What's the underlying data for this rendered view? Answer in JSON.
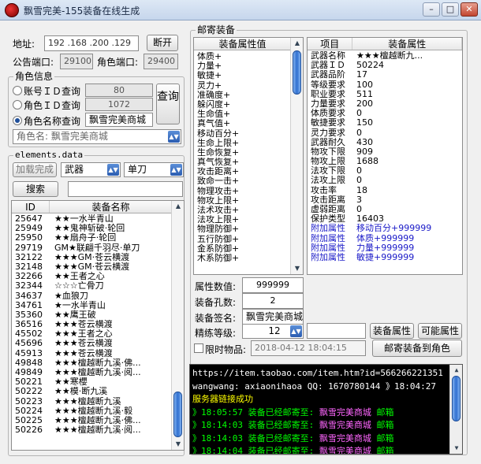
{
  "window": {
    "title": "飘雪完美-155装备在线生成"
  },
  "conn": {
    "addr_label": "地址:",
    "ip": "192 .168 .200 .129",
    "disconnect": "断开",
    "gm_port_label": "公告端口:",
    "gm_port": "29100",
    "role_port_label": "角色端口:",
    "role_port": "29400"
  },
  "role": {
    "group_title": "角色信息",
    "opt_account": "账号ＩＤ查询",
    "account_value": "80",
    "opt_roleid": "角色ＩＤ查询",
    "roleid_value": "1072",
    "opt_name": "角色名称查询",
    "name_value": "飘雪完美商城",
    "query": "查询",
    "rolename_combo": "角色名: 飘雪完美商城"
  },
  "elements": {
    "group_title": "elements.data",
    "load_btn": "加载完成",
    "cat1": "武器",
    "cat2": "单刀",
    "search_btn": "搜索",
    "search_value": "",
    "col_id": "ID",
    "col_name": "装备名称",
    "items": [
      {
        "id": "25647",
        "name": "★★一水半青山"
      },
      {
        "id": "25949",
        "name": "★★鬼神斩破·轮回"
      },
      {
        "id": "25950",
        "name": "★★扇舟子·轮回"
      },
      {
        "id": "29719",
        "name": "GM★联翩千羽尽·单刀"
      },
      {
        "id": "32122",
        "name": "★★★GM·苍云横渡"
      },
      {
        "id": "32148",
        "name": "★★★GM·苍云横渡"
      },
      {
        "id": "32266",
        "name": "★★王者之心"
      },
      {
        "id": "32344",
        "name": "☆☆☆亡骨刀"
      },
      {
        "id": "34637",
        "name": "★血狼刀"
      },
      {
        "id": "34761",
        "name": "★一水半青山"
      },
      {
        "id": "35360",
        "name": "★★鹰王破"
      },
      {
        "id": "36516",
        "name": "★★★苍云横渡"
      },
      {
        "id": "45502",
        "name": "★★★王者之心"
      },
      {
        "id": "45696",
        "name": "★★★苍云横渡"
      },
      {
        "id": "45913",
        "name": "★★★苍云横渡"
      },
      {
        "id": "49848",
        "name": "★★★檀越断九溪·佛..."
      },
      {
        "id": "49849",
        "name": "★★★檀越断九溪·阅..."
      },
      {
        "id": "50221",
        "name": "★★寒櫻"
      },
      {
        "id": "50222",
        "name": "★★模·断九溪"
      },
      {
        "id": "50223",
        "name": "★★★檀越断九溪"
      },
      {
        "id": "50224",
        "name": "★★★檀越断九溪·毅"
      },
      {
        "id": "50225",
        "name": "★★★檀越断九溪·佛..."
      },
      {
        "id": "50226",
        "name": "★★★檀越断九溪·阅..."
      }
    ]
  },
  "mail": {
    "group_title": "邮寄装备",
    "attr_header": "装备属性值",
    "attr_list": [
      "体质+",
      "力量+",
      "敏捷+",
      "灵力+",
      "准确度+",
      "躲闪度+",
      "生命值+",
      "真气值+",
      "移动百分+",
      "生命上限+",
      "生命恢复+",
      "真气恢复+",
      "攻击距离+",
      "致命一击+",
      "物理攻击+",
      "物攻上限+",
      "法术攻击+",
      "法攻上限+",
      "物理防御+",
      "五行防御+",
      "金系防御+",
      "木系防御+"
    ],
    "col_item": "项目",
    "col_prop": "装备属性",
    "props": [
      {
        "k": "武器名称",
        "v": "★★★檀越断九..."
      },
      {
        "k": "武器ＩＤ",
        "v": "50224"
      },
      {
        "k": "武器品阶",
        "v": "17"
      },
      {
        "k": "等级要求",
        "v": "100"
      },
      {
        "k": "职业要求",
        "v": "511"
      },
      {
        "k": "力量要求",
        "v": "200"
      },
      {
        "k": "体质要求",
        "v": "0"
      },
      {
        "k": "敏捷要求",
        "v": "150"
      },
      {
        "k": "灵力要求",
        "v": "0"
      },
      {
        "k": "武器耐久",
        "v": "430"
      },
      {
        "k": "物攻下限",
        "v": "909"
      },
      {
        "k": "物攻上限",
        "v": "1688"
      },
      {
        "k": "法攻下限",
        "v": "0"
      },
      {
        "k": "法攻上限",
        "v": "0"
      },
      {
        "k": "攻击率",
        "v": "18"
      },
      {
        "k": "攻击距离",
        "v": "3"
      },
      {
        "k": "虚弱距离",
        "v": "0"
      },
      {
        "k": "保护类型",
        "v": "16403"
      },
      {
        "k": "附加属性",
        "v": "移动百分+999999",
        "blue": true
      },
      {
        "k": "附加属性",
        "v": "体质+999999",
        "blue": true
      },
      {
        "k": "附加属性",
        "v": "力量+999999",
        "blue": true
      },
      {
        "k": "附加属性",
        "v": "敏捷+999999",
        "blue": true
      }
    ],
    "attr_value_label": "属性数值:",
    "attr_value": "999999",
    "holes_label": "装备孔数:",
    "holes": "2",
    "sign_label": "装备签名:",
    "sign": "飘雪完美商城",
    "refine_label": "精练等级:",
    "refine": "12",
    "refine_extra": "",
    "btn_equip_attr": "装备属性",
    "btn_possible": "可能属性",
    "limit_label": "限时物品:",
    "limit_time": "2018-04-12 18:04:15",
    "send_btn": "邮寄装备到角色"
  },
  "console": {
    "lines": [
      {
        "t": "https://item.taobao.com/item.htm?id=566266221351",
        "c": "#ffffff"
      },
      {
        "t": "wangwang: axiaonihaoa          QQ: 1670780144  》18:04:27",
        "c": "#ffffff"
      },
      {
        "t": "服务器链接成功",
        "c": "#ffff00"
      },
      {
        "t": "》18:05:57 装备已经邮寄至:  飘雪完美商城 邮箱",
        "c": "#00ff00",
        "hl": "飘雪完美商城"
      },
      {
        "t": "》18:14:03 装备已经邮寄至:  飘雪完美商城 邮箱",
        "c": "#00ff00",
        "hl": "飘雪完美商城"
      },
      {
        "t": "》18:14:03 装备已经邮寄至:  飘雪完美商城 邮箱",
        "c": "#00ff00",
        "hl": "飘雪完美商城"
      },
      {
        "t": "》18:14:04 装备已经邮寄至:  飘雪完美商城 邮箱",
        "c": "#00ff00",
        "hl": "飘雪完美商城"
      },
      {
        "t": "》18:14:04 装备已经邮寄至:  飘雪完美商城 邮箱",
        "c": "#00ff00",
        "hl": "飘雪完美商城"
      }
    ]
  },
  "colors": {
    "accent": "#2f6fd0",
    "link_blue": "#1a1ac8",
    "console_name": "#ff66ff"
  }
}
